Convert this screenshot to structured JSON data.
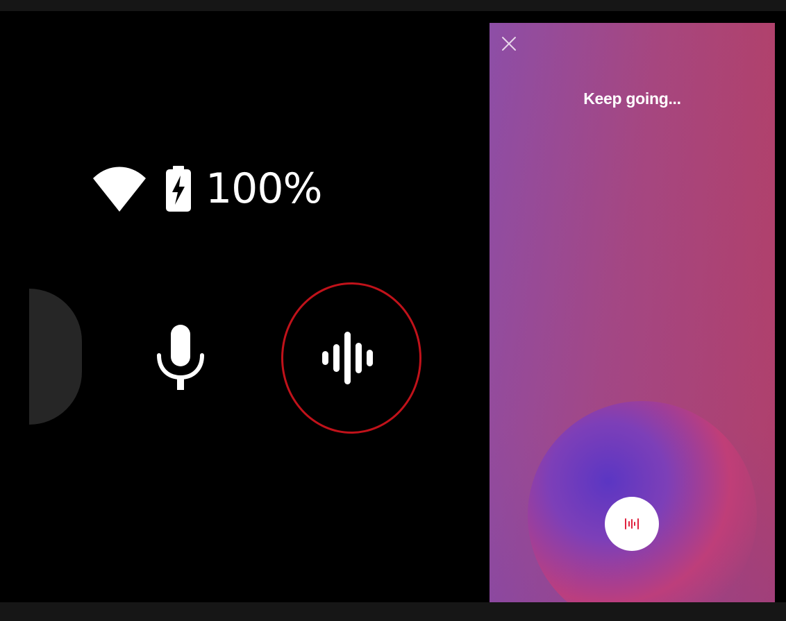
{
  "watch": {
    "battery_percent": "100%",
    "icons": {
      "wifi": "wifi-icon",
      "battery": "battery-charging-icon",
      "mic": "microphone-icon",
      "voice": "voice-bars-icon"
    },
    "highlight_color": "#c0121a"
  },
  "assistant_panel": {
    "title": "Keep going...",
    "close_icon": "close-icon",
    "listen_icon": "listening-wave-icon",
    "accent_color": "#e0223f",
    "gradient_colors": [
      "#8d4ea7",
      "#a7467e",
      "#b93d5c"
    ]
  }
}
